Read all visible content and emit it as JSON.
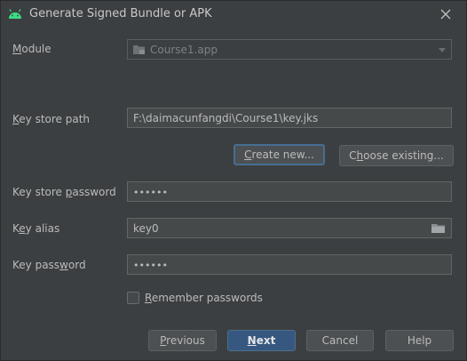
{
  "window": {
    "title": "Generate Signed Bundle or APK"
  },
  "module": {
    "label_pre": "",
    "label_mnemonic": "M",
    "label_post": "odule",
    "value": "Course1.app"
  },
  "key_store_path": {
    "label_pre": "",
    "label_mnemonic": "K",
    "label_post": "ey store path",
    "value": "F:\\daimacunfangdi\\Course1\\key.jks"
  },
  "keystore_buttons": {
    "create_pre": "",
    "create_mnemonic": "C",
    "create_post": "reate new...",
    "choose_pre": "C",
    "choose_mnemonic": "h",
    "choose_post": "oose existing..."
  },
  "key_store_password": {
    "label_pre": "Key store ",
    "label_mnemonic": "p",
    "label_post": "assword",
    "value": "••••••"
  },
  "key_alias": {
    "label_pre": "K",
    "label_mnemonic": "e",
    "label_post": "y alias",
    "value": "key0"
  },
  "key_password": {
    "label_pre": "Key pass",
    "label_mnemonic": "w",
    "label_post": "ord",
    "value": "••••••"
  },
  "remember": {
    "label_pre": "",
    "label_mnemonic": "R",
    "label_post": "emember passwords",
    "checked": false
  },
  "footer": {
    "previous_pre": "",
    "previous_mnemonic": "P",
    "previous_post": "revious",
    "next_pre": "",
    "next_mnemonic": "N",
    "next_post": "ext",
    "cancel": "Cancel",
    "help": "Help"
  },
  "colors": {
    "background": "#3c3f41",
    "field": "#45494a",
    "primary_button": "#365880",
    "android_green": "#3ddc84"
  },
  "icons": {
    "app": "android-icon",
    "close": "close-icon",
    "module": "module-folder-icon",
    "browse": "folder-icon"
  }
}
